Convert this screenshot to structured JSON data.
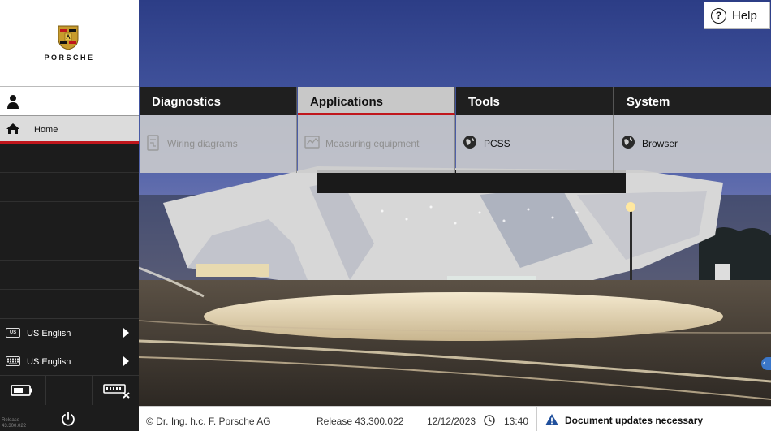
{
  "brand": {
    "name": "PORSCHE"
  },
  "help": {
    "label": "Help",
    "icon": "question-circle-icon"
  },
  "sidebar": {
    "user_icon": "user-icon",
    "home": {
      "label": "Home",
      "icon": "home-icon"
    },
    "languages": [
      {
        "badge": "US",
        "label": "US English",
        "icon": "flag-badge-icon"
      },
      {
        "badge": "",
        "label": "US English",
        "icon": "keyboard-icon"
      }
    ],
    "tools": {
      "battery_icon": "battery-icon",
      "vci_icon": "vci-disconnected-icon",
      "power_icon": "power-icon"
    },
    "release_mini": [
      "Release",
      "43.300.022"
    ]
  },
  "menu": [
    {
      "title": "Diagnostics",
      "active": false,
      "item": {
        "label": "Wiring diagrams",
        "enabled": false,
        "icon": "wiring-diagram-icon"
      }
    },
    {
      "title": "Applications",
      "active": true,
      "item": {
        "label": "Measuring equipment",
        "enabled": false,
        "icon": "measuring-equipment-icon"
      }
    },
    {
      "title": "Tools",
      "active": false,
      "item": {
        "label": "PCSS",
        "enabled": true,
        "icon": "globe-icon"
      }
    },
    {
      "title": "System",
      "active": false,
      "item": {
        "label": "Browser",
        "enabled": true,
        "icon": "globe-icon"
      }
    }
  ],
  "footer": {
    "copyright": "© Dr. Ing. h.c. F. Porsche AG",
    "release": "Release 43.300.022",
    "date": "12/12/2023",
    "time": "13:40",
    "notice": "Document updates necessary"
  },
  "colors": {
    "accent": "#c0161c",
    "info": "#3b77c9",
    "warning_icon": "#1f4f9c"
  }
}
